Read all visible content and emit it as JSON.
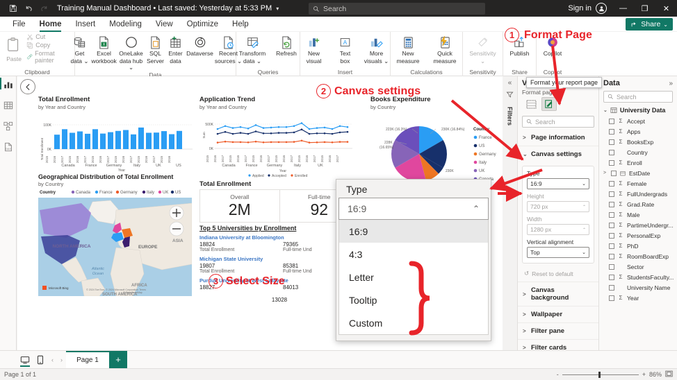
{
  "titlebar": {
    "save_icon": "save-icon",
    "undo_icon": "undo-icon",
    "redo_icon": "redo-icon",
    "document_title": "Training Manual Dashboard  •  Last saved: Yesterday at 5:33 PM",
    "caret": "▾",
    "search_placeholder": "Search",
    "sign_in": "Sign in",
    "minimize": "—",
    "restore": "❐",
    "close": "✕"
  },
  "menu": {
    "items": [
      {
        "label": "File",
        "active": false
      },
      {
        "label": "Home",
        "active": true
      },
      {
        "label": "Insert",
        "active": false
      },
      {
        "label": "Modeling",
        "active": false
      },
      {
        "label": "View",
        "active": false
      },
      {
        "label": "Optimize",
        "active": false
      },
      {
        "label": "Help",
        "active": false
      }
    ],
    "share_label": "Share",
    "share_caret": "⌄"
  },
  "ribbon": {
    "groups": [
      {
        "name": "Clipboard",
        "label": "Clipboard",
        "paste_label": "Paste",
        "items": [
          "Cut",
          "Copy",
          "Format painter"
        ]
      },
      {
        "name": "Data",
        "label": "Data",
        "buttons": [
          {
            "label": "Get\ndata ⌄",
            "l1": "Get",
            "l2": "data ⌄"
          },
          {
            "label": "Excel workbook",
            "l1": "Excel",
            "l2": "workbook"
          },
          {
            "label": "OneLake data hub",
            "l1": "OneLake",
            "l2": "data hub ⌄"
          },
          {
            "label": "SQL Server",
            "l1": "SQL",
            "l2": "Server"
          },
          {
            "label": "Enter data",
            "l1": "Enter",
            "l2": "data"
          },
          {
            "label": "Dataverse",
            "l1": "Dataverse",
            "l2": ""
          },
          {
            "label": "Recent sources",
            "l1": "Recent",
            "l2": "sources ⌄"
          }
        ]
      },
      {
        "name": "Queries",
        "label": "Queries",
        "buttons": [
          {
            "l1": "Transform",
            "l2": "data ⌄"
          },
          {
            "l1": "Refresh",
            "l2": ""
          }
        ]
      },
      {
        "name": "Insert",
        "label": "Insert",
        "buttons": [
          {
            "l1": "New",
            "l2": "visual"
          },
          {
            "l1": "Text",
            "l2": "box"
          },
          {
            "l1": "More",
            "l2": "visuals ⌄"
          }
        ]
      },
      {
        "name": "Calculations",
        "label": "Calculations",
        "buttons": [
          {
            "l1": "New",
            "l2": "measure"
          },
          {
            "l1": "Quick",
            "l2": "measure"
          }
        ]
      },
      {
        "name": "Sensitivity",
        "label": "Sensitivity",
        "buttons": [
          {
            "l1": "Sensitivity",
            "l2": "⌄"
          }
        ]
      },
      {
        "name": "Share",
        "label": "Share",
        "buttons": [
          {
            "l1": "Publish",
            "l2": ""
          }
        ]
      },
      {
        "name": "Copilot",
        "label": "Copilot",
        "buttons": [
          {
            "l1": "Copilot",
            "l2": ""
          }
        ]
      }
    ]
  },
  "rail": {
    "items": [
      "report-view-icon",
      "table-view-icon",
      "model-view-icon",
      "dax-query-view-icon"
    ]
  },
  "canvas": {
    "back_icon": "back-arrow-icon",
    "visuals": {
      "total_enrollment_bar": {
        "title": "Total Enrollment",
        "subtitle": "by Year and Country"
      },
      "application_trend": {
        "title": "Application Trend",
        "subtitle": "by Year and Country"
      },
      "books_expenditure": {
        "title": "Books Expenditure",
        "subtitle": "by Country",
        "legend_title": "Country",
        "callouts": [
          "223K (16.3%)",
          "228K (16.65%)",
          "230K (16.84%)",
          "230K"
        ]
      },
      "geo_map": {
        "title": "Geographical Distribution of Total Enrollment",
        "subtitle": "by Country",
        "legend_title": "Country",
        "map_labels": [
          "NORTH AMERICA",
          "EUROPE",
          "ASIA",
          "AFRICA",
          "SOUTH AMERICA",
          "Atlantic Ocean"
        ],
        "attribution": "© 2024 TomTom, © 2024 Microsoft Corporation   Terms",
        "brand": "Microsoft Bing",
        "zoom_in": "+",
        "zoom_out": "−"
      },
      "cards": {
        "title": "Total Enrollment",
        "items": [
          {
            "label": "Overall",
            "value": "2M"
          },
          {
            "label": "Full-time",
            "value": "92"
          }
        ]
      },
      "top5": {
        "title": "Top 5 Universities by Enrollment",
        "rows": [
          {
            "name": "Indiana University at Bloomington",
            "v1": "18824",
            "l1": "Total Enrollment",
            "v2": "79365",
            "l2": "Full-time Und"
          },
          {
            "name": "Michigan State University",
            "v1": "19807",
            "l1": "Total Enrollment",
            "v2": "85381",
            "l2": "Full-time Und"
          },
          {
            "name": "Purdue University at West Lafayette",
            "v1": "18827",
            "l1": "",
            "v2": "84013",
            "l2": ""
          }
        ],
        "footer_value": "13028"
      }
    }
  },
  "chart_data": [
    {
      "type": "bar",
      "title": "Total Enrollment",
      "subtitle": "by Year and Country",
      "xlabel": "Year",
      "ylabel": "Total Enrollment",
      "ylim": [
        0,
        150000
      ],
      "yticks": [
        "0K",
        "100K"
      ],
      "groups": [
        "Canada",
        "France",
        "Germany",
        "Italy",
        "UK",
        "US"
      ],
      "categories": [
        "2015",
        "2016",
        "2017",
        "2015",
        "2016",
        "2017",
        "2015",
        "2016",
        "2017",
        "2015",
        "2016",
        "2017",
        "2015",
        "2016",
        "2017",
        "2015",
        "2016"
      ],
      "values": [
        88000,
        122000,
        100000,
        110000,
        97000,
        122000,
        98000,
        104000,
        112000,
        118000,
        90000,
        133000,
        100000,
        102000,
        111000,
        92000,
        112000
      ],
      "color": "#2a9df4"
    },
    {
      "type": "line",
      "title": "Application Trend",
      "subtitle": "by Year and Country",
      "xlabel": "Year",
      "ylabel": "Sum",
      "ylim": [
        0,
        600000
      ],
      "yticks": [
        "0K",
        "500K"
      ],
      "groups": [
        "Canada",
        "France",
        "Germany",
        "Italy",
        "UK"
      ],
      "x": [
        "2015",
        "2016",
        "2017",
        "2015",
        "2016",
        "2017",
        "2015",
        "2016",
        "2017",
        "2015",
        "2016",
        "2017",
        "2015",
        "2016",
        "2017",
        "2015",
        "2016",
        "2017"
      ],
      "series": [
        {
          "name": "Applied",
          "color": "#2a9df4",
          "values": [
            400000,
            460000,
            420000,
            440000,
            410000,
            480000,
            420000,
            430000,
            440000,
            440000,
            460000,
            520000,
            400000,
            420000,
            430000,
            400000,
            460000,
            440000
          ]
        },
        {
          "name": "Accepted",
          "color": "#17306b",
          "values": [
            300000,
            340000,
            300000,
            320000,
            300000,
            350000,
            310000,
            310000,
            320000,
            320000,
            330000,
            390000,
            300000,
            310000,
            310000,
            300000,
            330000,
            340000
          ]
        },
        {
          "name": "Enrolled",
          "color": "#ee5b28",
          "values": [
            120000,
            140000,
            130000,
            130000,
            125000,
            140000,
            125000,
            130000,
            130000,
            130000,
            135000,
            160000,
            120000,
            125000,
            130000,
            125000,
            135000,
            135000
          ]
        }
      ],
      "legend": [
        "Applied",
        "Accepted",
        "Enrolled"
      ],
      "legend_position": "bottom"
    },
    {
      "type": "pie",
      "title": "Books Expenditure",
      "subtitle": "by Country",
      "legend_title": "Country",
      "slices": [
        {
          "label": "France",
          "value": 230000,
          "pct": "16.84%",
          "color": "#2a9df4"
        },
        {
          "label": "US",
          "value": 230000,
          "pct": "16.8%",
          "color": "#17306b"
        },
        {
          "label": "Germany",
          "value": 20000,
          "pct": "1.5%",
          "color": "#ee7624"
        },
        {
          "label": "Italy",
          "value": 228000,
          "pct": "16.65%",
          "color": "#e0479e"
        },
        {
          "label": "UK",
          "value": 223000,
          "pct": "16.3%",
          "color": "#8764b8"
        },
        {
          "label": "Canada",
          "value": 230000,
          "pct": "16.84%",
          "color": "#6b4fbb"
        }
      ],
      "legend": [
        "France",
        "US",
        "Germany",
        "Italy",
        "UK",
        "Canada"
      ]
    },
    {
      "type": "map",
      "title": "Geographical Distribution of Total Enrollment",
      "subtitle": "by Country",
      "legend_title": "Country",
      "legend": [
        {
          "label": "Canada",
          "color": "#8764b8"
        },
        {
          "label": "France",
          "color": "#2a9df4"
        },
        {
          "label": "Germany",
          "color": "#ee5b28"
        },
        {
          "label": "Italy",
          "color": "#3b1d6e"
        },
        {
          "label": "UK",
          "color": "#e0479e"
        },
        {
          "label": "US",
          "color": "#17306b"
        }
      ]
    }
  ],
  "panebar": {
    "collapse_icon": "chevron-double-left-icon",
    "filter_icon": "filter-icon",
    "filters_label": "Filters"
  },
  "format_pane": {
    "title": "V",
    "expand_icon": "chevron-double-right-icon",
    "format_page_label": "Format page",
    "seg_buttons": [
      "canvas-grid-icon",
      "format-brush-icon"
    ],
    "search_placeholder": "Search",
    "sections": [
      {
        "label": "Page information",
        "expanded": false
      },
      {
        "label": "Canvas settings",
        "expanded": true
      }
    ],
    "canvas_settings": {
      "type_label": "Type",
      "type_value": "16:9",
      "height_label": "Height",
      "height_value": "720 px",
      "width_label": "Width",
      "width_value": "1280 px",
      "valign_label": "Vertical alignment",
      "valign_value": "Top"
    },
    "reset_label": "Reset to default",
    "more_sections": [
      "Canvas background",
      "Wallpaper",
      "Filter pane",
      "Filter cards"
    ]
  },
  "data_pane": {
    "title": "Data",
    "expand_icon": "chevron-double-right-icon",
    "search_placeholder": "Search",
    "table": "University Data",
    "fields": [
      {
        "name": "Accept",
        "sigma": true
      },
      {
        "name": "Apps",
        "sigma": true
      },
      {
        "name": "BooksExp",
        "sigma": true
      },
      {
        "name": "Country",
        "sigma": false
      },
      {
        "name": "Enroll",
        "sigma": true
      },
      {
        "name": "EstDate",
        "sigma": false,
        "expandable": true,
        "calendar": true
      },
      {
        "name": "Female",
        "sigma": true
      },
      {
        "name": "FullUndergrads",
        "sigma": true
      },
      {
        "name": "Grad.Rate",
        "sigma": true
      },
      {
        "name": "Male",
        "sigma": true
      },
      {
        "name": "PartimeUndergr...",
        "sigma": true
      },
      {
        "name": "PersonalExp",
        "sigma": true
      },
      {
        "name": "PhD",
        "sigma": true
      },
      {
        "name": "RoomBoardExp",
        "sigma": true
      },
      {
        "name": "Sector",
        "sigma": false
      },
      {
        "name": "StudentsFaculty...",
        "sigma": true
      },
      {
        "name": "University Name",
        "sigma": false
      },
      {
        "name": "Year",
        "sigma": true
      }
    ]
  },
  "dropdown": {
    "label": "Type",
    "selected": "16:9",
    "chevron": "⌃",
    "options": [
      "16:9",
      "4:3",
      "Letter",
      "Tooltip",
      "Custom"
    ]
  },
  "tooltip": {
    "text": "Format your report page"
  },
  "annotations": [
    {
      "num": "1",
      "text": "Format Page"
    },
    {
      "num": "2",
      "text": "Canvas settings"
    },
    {
      "num": "3",
      "text": "Select Size"
    }
  ],
  "pagebar": {
    "desktop_icon": "desktop-layout-icon",
    "mobile_icon": "mobile-layout-icon",
    "prev": "‹",
    "next": "›",
    "page_tab": "Page 1",
    "add_page": "+"
  },
  "statusbar": {
    "page_status": "Page 1 of 1",
    "zoom_minus": "-",
    "zoom_plus": "+",
    "zoom_value": "86%",
    "fit_icon": "fit-to-page-icon"
  },
  "colors": {
    "accent": "#117865",
    "annotation": "#e8242a",
    "series_blue": "#2a9df4",
    "series_navy": "#17306b",
    "series_orange": "#ee5b28"
  }
}
